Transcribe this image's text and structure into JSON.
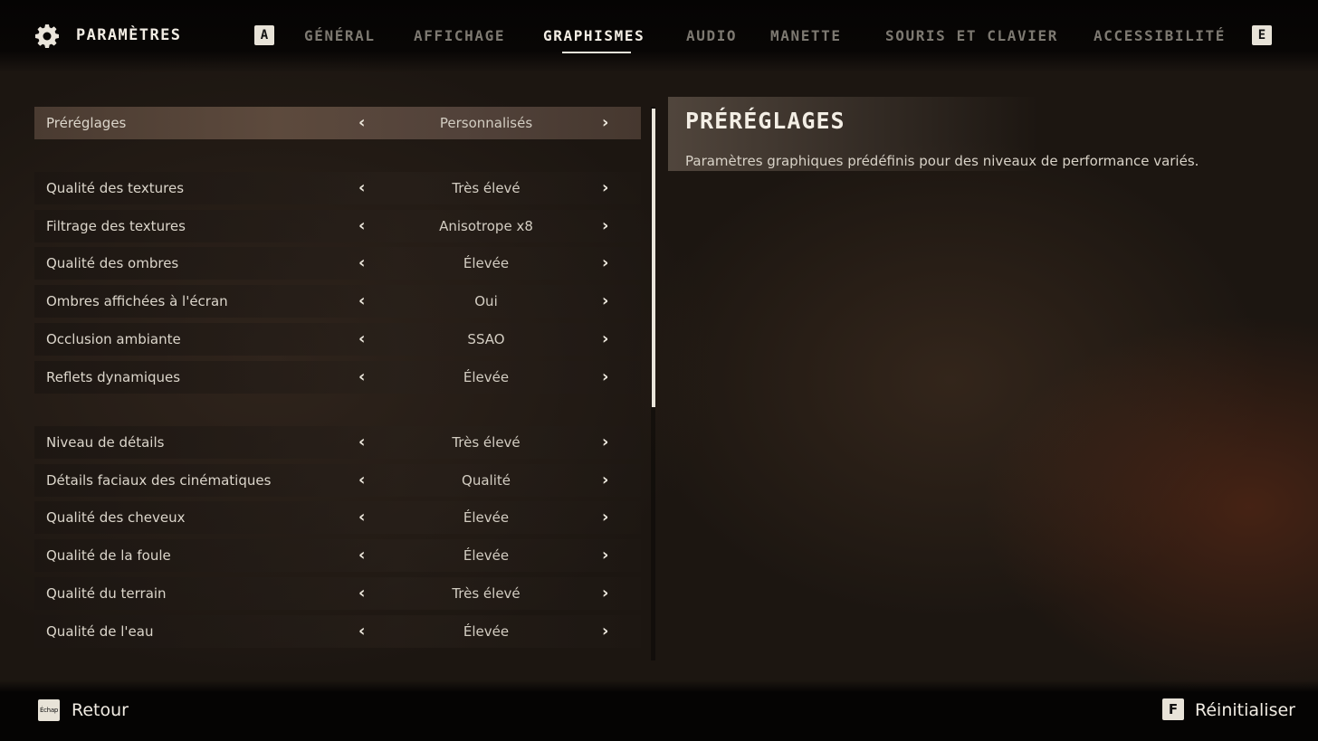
{
  "header": {
    "title": "PARAMÈTRES",
    "prev_key": "A",
    "next_key": "E",
    "tabs": [
      {
        "label": "GÉNÉRAL"
      },
      {
        "label": "AFFICHAGE"
      },
      {
        "label": "GRAPHISMES",
        "active": true
      },
      {
        "label": "AUDIO"
      },
      {
        "label": "MANETTE"
      },
      {
        "label": "SOURIS ET CLAVIER"
      },
      {
        "label": "ACCESSIBILITÉ"
      }
    ]
  },
  "settings": {
    "rows": [
      {
        "label": "Préréglages",
        "value": "Personnalisés"
      },
      {
        "label": "Qualité des textures",
        "value": "Très élevé"
      },
      {
        "label": "Filtrage des textures",
        "value": "Anisotrope x8"
      },
      {
        "label": "Qualité des ombres",
        "value": "Élevée"
      },
      {
        "label": "Ombres affichées à l'écran",
        "value": "Oui"
      },
      {
        "label": "Occlusion ambiante",
        "value": "SSAO"
      },
      {
        "label": "Reflets dynamiques",
        "value": "Élevée"
      },
      {
        "label": "Niveau de détails",
        "value": "Très élevé"
      },
      {
        "label": "Détails faciaux des cinématiques",
        "value": "Qualité"
      },
      {
        "label": "Qualité des cheveux",
        "value": "Élevée"
      },
      {
        "label": "Qualité de la foule",
        "value": "Élevée"
      },
      {
        "label": "Qualité du terrain",
        "value": "Très élevé"
      },
      {
        "label": "Qualité de l'eau",
        "value": "Élevée"
      }
    ],
    "arrow_left": "‹",
    "arrow_right": "›"
  },
  "info": {
    "heading": "PRÉRÉGLAGES",
    "description": "Paramètres graphiques prédéfinis pour des niveaux de performance variés."
  },
  "footer": {
    "back_key": "Échap",
    "back_label": "Retour",
    "reset_key": "F",
    "reset_label": "Réinitialiser"
  },
  "colors": {
    "accent": "#e9e4da",
    "selected_row": "#5d4a3d"
  }
}
